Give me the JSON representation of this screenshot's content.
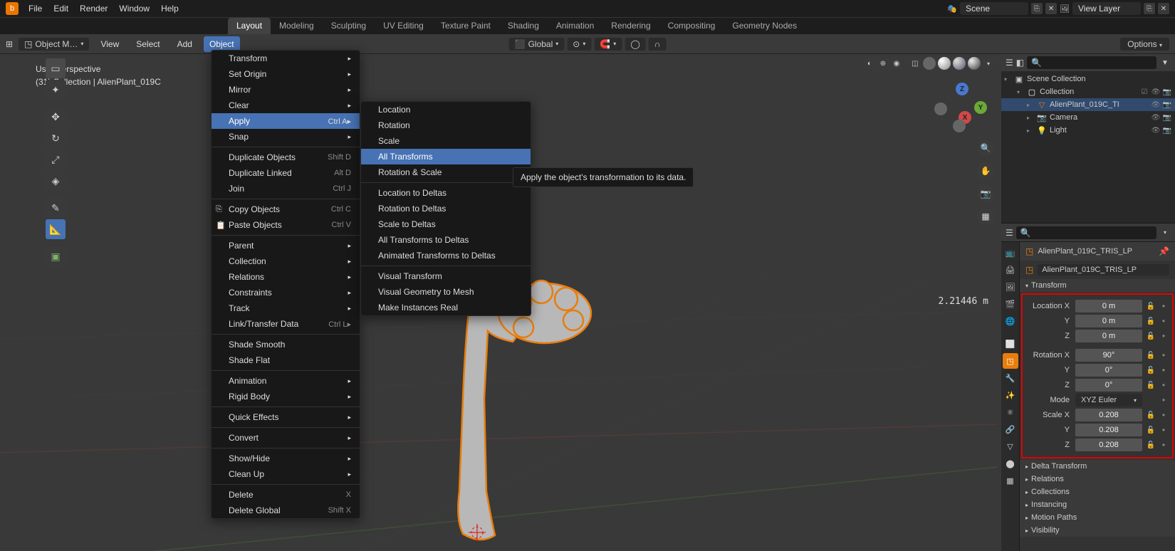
{
  "top_menu": [
    "File",
    "Edit",
    "Render",
    "Window",
    "Help"
  ],
  "workspace_tabs": [
    "Layout",
    "Modeling",
    "Sculpting",
    "UV Editing",
    "Texture Paint",
    "Shading",
    "Animation",
    "Rendering",
    "Compositing",
    "Geometry Nodes"
  ],
  "active_workspace": "Layout",
  "scene": {
    "name": "Scene",
    "view_layer": "View Layer"
  },
  "mode_selector": "Object M…",
  "header_menus": [
    "View",
    "Select",
    "Add",
    "Object"
  ],
  "active_header_menu": "Object",
  "transform_orientation": "Global",
  "options_label": "Options",
  "viewport_info": {
    "line1": "User Perspective",
    "line2": "(31) Collection | AlienPlant_019C"
  },
  "measurement": "2.21446 m",
  "object_menu": [
    {
      "type": "item",
      "label": "Transform",
      "sub": true
    },
    {
      "type": "item",
      "label": "Set Origin",
      "sub": true
    },
    {
      "type": "item",
      "label": "Mirror",
      "sub": true
    },
    {
      "type": "item",
      "label": "Clear",
      "sub": true
    },
    {
      "type": "item",
      "label": "Apply",
      "shortcut": "Ctrl A▸",
      "highlighted": true
    },
    {
      "type": "item",
      "label": "Snap",
      "sub": true
    },
    {
      "type": "sep"
    },
    {
      "type": "item",
      "label": "Duplicate Objects",
      "shortcut": "Shift D"
    },
    {
      "type": "item",
      "label": "Duplicate Linked",
      "shortcut": "Alt D"
    },
    {
      "type": "item",
      "label": "Join",
      "shortcut": "Ctrl J"
    },
    {
      "type": "sep"
    },
    {
      "type": "item",
      "label": "Copy Objects",
      "shortcut": "Ctrl C",
      "icon": "⎘"
    },
    {
      "type": "item",
      "label": "Paste Objects",
      "shortcut": "Ctrl V",
      "icon": "📋"
    },
    {
      "type": "sep"
    },
    {
      "type": "item",
      "label": "Parent",
      "sub": true
    },
    {
      "type": "item",
      "label": "Collection",
      "sub": true
    },
    {
      "type": "item",
      "label": "Relations",
      "sub": true
    },
    {
      "type": "item",
      "label": "Constraints",
      "sub": true
    },
    {
      "type": "item",
      "label": "Track",
      "sub": true
    },
    {
      "type": "item",
      "label": "Link/Transfer Data",
      "shortcut": "Ctrl L▸"
    },
    {
      "type": "sep"
    },
    {
      "type": "item",
      "label": "Shade Smooth"
    },
    {
      "type": "item",
      "label": "Shade Flat"
    },
    {
      "type": "sep"
    },
    {
      "type": "item",
      "label": "Animation",
      "sub": true
    },
    {
      "type": "item",
      "label": "Rigid Body",
      "sub": true
    },
    {
      "type": "sep"
    },
    {
      "type": "item",
      "label": "Quick Effects",
      "sub": true
    },
    {
      "type": "sep"
    },
    {
      "type": "item",
      "label": "Convert",
      "sub": true
    },
    {
      "type": "sep"
    },
    {
      "type": "item",
      "label": "Show/Hide",
      "sub": true
    },
    {
      "type": "item",
      "label": "Clean Up",
      "sub": true
    },
    {
      "type": "sep"
    },
    {
      "type": "item",
      "label": "Delete",
      "shortcut": "X"
    },
    {
      "type": "item",
      "label": "Delete Global",
      "shortcut": "Shift X"
    }
  ],
  "apply_submenu": [
    {
      "type": "item",
      "label": "Location"
    },
    {
      "type": "item",
      "label": "Rotation"
    },
    {
      "type": "item",
      "label": "Scale"
    },
    {
      "type": "item",
      "label": "All Transforms",
      "highlighted": true
    },
    {
      "type": "item",
      "label": "Rotation & Scale"
    },
    {
      "type": "sep"
    },
    {
      "type": "item",
      "label": "Location to Deltas"
    },
    {
      "type": "item",
      "label": "Rotation to Deltas"
    },
    {
      "type": "item",
      "label": "Scale to Deltas"
    },
    {
      "type": "item",
      "label": "All Transforms to Deltas"
    },
    {
      "type": "item",
      "label": "Animated Transforms to Deltas"
    },
    {
      "type": "sep"
    },
    {
      "type": "item",
      "label": "Visual Transform"
    },
    {
      "type": "item",
      "label": "Visual Geometry to Mesh"
    },
    {
      "type": "item",
      "label": "Make Instances Real"
    }
  ],
  "tooltip": "Apply the object's transformation to its data.",
  "outliner": {
    "root": "Scene Collection",
    "collection": "Collection",
    "items": [
      {
        "name": "AlienPlant_019C_TI",
        "icon": "▽",
        "selected": true,
        "color": "#e87d0d"
      },
      {
        "name": "Camera",
        "icon": "📷",
        "color": "#e8a33d"
      },
      {
        "name": "Light",
        "icon": "💡",
        "color": "#e8a33d"
      }
    ]
  },
  "properties": {
    "object_name": "AlienPlant_019C_TRIS_LP",
    "object_path": "AlienPlant_019C_TRIS_LP",
    "transform": {
      "label": "Transform",
      "location": {
        "label": "Location X",
        "x": "0 m",
        "y": "0 m",
        "z": "0 m"
      },
      "rotation": {
        "label": "Rotation X",
        "x": "90°",
        "y": "0°",
        "z": "0°"
      },
      "mode": {
        "label": "Mode",
        "value": "XYZ Euler"
      },
      "scale": {
        "label": "Scale X",
        "x": "0.208",
        "y": "0.208",
        "z": "0.208"
      }
    },
    "sections": [
      "Delta Transform",
      "Relations",
      "Collections",
      "Instancing",
      "Motion Paths",
      "Visibility"
    ]
  }
}
